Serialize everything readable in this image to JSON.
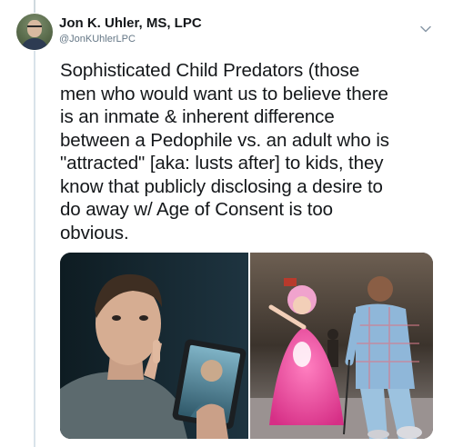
{
  "tweet": {
    "author_name": "Jon K. Uhler, MS, LPC",
    "author_handle": "@JonKUhlerLPC",
    "text": "Sophisticated Child Predators (those\nmen who would want us to believe there\nis an inmate & inherent difference\nbetween a Pedophile vs. an adult who is\n\"attracted\" [aka: lusts after] to kids, they\nknow that publicly disclosing a desire to\ndo away w/ Age of Consent is too\nobvious.",
    "icons": {
      "avatar": "author-avatar",
      "menu": "chevron-down-icon"
    },
    "media": {
      "left_image": "man-with-finger-on-lips-holding-tablet",
      "right_image": "child-in-pink-costume-with-adult-in-plaid-suit"
    }
  },
  "colors": {
    "text_primary": "#14171a",
    "text_secondary": "#657786",
    "thread_line": "#cfd9de",
    "costume_pink": "#e8449a",
    "suit_plaid": "#8fb7d9"
  }
}
